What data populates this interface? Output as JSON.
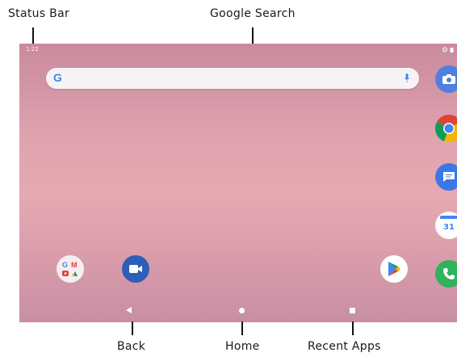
{
  "annotations": {
    "status_bar": "Status Bar",
    "google_search": "Google Search",
    "back": "Back",
    "home": "Home",
    "recent_apps": "Recent Apps"
  },
  "status_bar": {
    "time": "1:22",
    "icons": [
      "wifi-icon",
      "battery-icon"
    ]
  },
  "search": {
    "logo": "G",
    "icons": [
      "google-g-icon",
      "mic-icon"
    ]
  },
  "dock_right": {
    "apps": [
      "camera-icon",
      "chrome-icon",
      "messages-icon",
      "calendar-icon",
      "phone-icon"
    ],
    "calendar_day": "31"
  },
  "home_apps": [
    "google-apps-folder-icon",
    "duo-video-icon",
    "play-store-icon"
  ],
  "nav_bar": [
    "back-icon",
    "home-icon",
    "recent-apps-icon"
  ],
  "colors": {
    "camera": "#4f7fe0",
    "chrome_red": "#db4437",
    "chrome_yellow": "#f4b400",
    "chrome_green": "#0f9d58",
    "chrome_blue": "#4285f4",
    "messages": "#3b78e7",
    "calendar": "#4285f4",
    "phone": "#2fb35b",
    "duo": "#2d5fb8"
  }
}
